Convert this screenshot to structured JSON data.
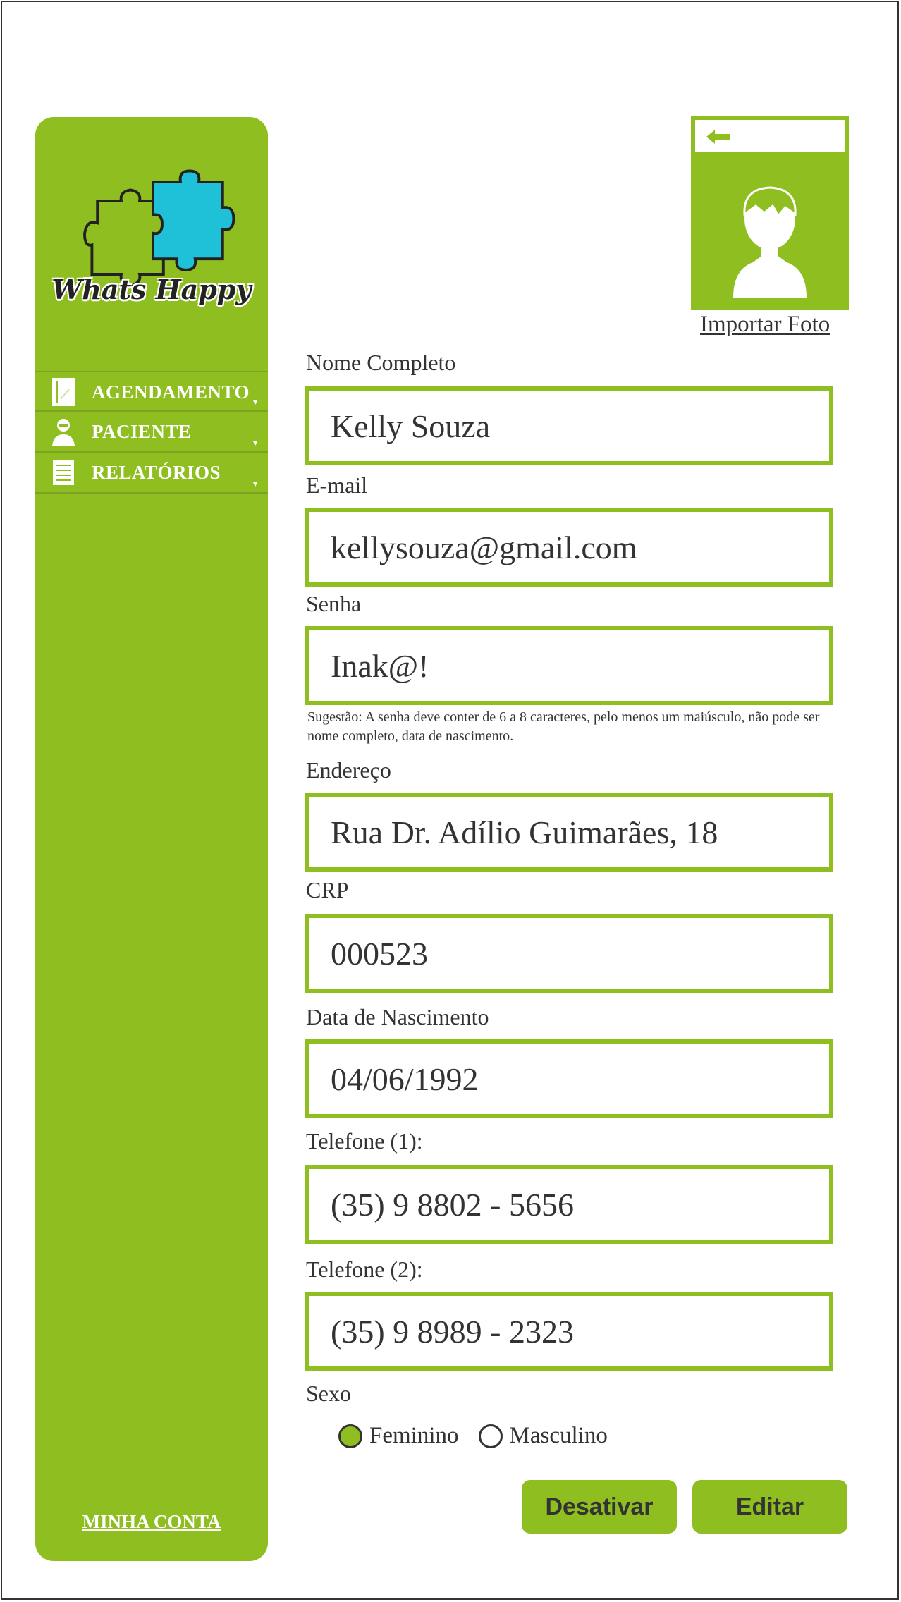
{
  "brand": {
    "name": "Whats Happy"
  },
  "sidebar": {
    "items": [
      {
        "label": "AGENDAMENTO",
        "icon": "notebook-icon"
      },
      {
        "label": "PACIENTE",
        "icon": "person-icon"
      },
      {
        "label": "RELATÓRIOS",
        "icon": "document-icon"
      }
    ],
    "account_label": "MINHA CONTA"
  },
  "photo": {
    "import_label": "Importar Foto"
  },
  "form": {
    "name": {
      "label": "Nome Completo",
      "value": "Kelly Souza"
    },
    "email": {
      "label": "E-mail",
      "value": "kellysouza@gmail.com"
    },
    "password": {
      "label": "Senha",
      "value": "Inak@!",
      "hint": "Sugestão: A senha deve conter de 6 a 8 caracteres, pelo menos um maiúsculo, não pode ser nome completo, data de nascimento."
    },
    "address": {
      "label": "Endereço",
      "value": "Rua Dr. Adílio Guimarães, 18"
    },
    "crp": {
      "label": "CRP",
      "value": "000523"
    },
    "birthdate": {
      "label": "Data de Nascimento",
      "value": "04/06/1992"
    },
    "phone1": {
      "label": "Telefone (1):",
      "value": "(35) 9 8802 - 5656"
    },
    "phone2": {
      "label": "Telefone (2):",
      "value": "(35) 9 8989 - 2323"
    },
    "sex": {
      "label": "Sexo",
      "options": [
        "Feminino",
        "Masculino"
      ],
      "selected": "Feminino"
    }
  },
  "actions": {
    "deactivate_label": "Desativar",
    "edit_label": "Editar"
  },
  "colors": {
    "accent": "#8fbe20",
    "puzzle_blue": "#1fc1d8"
  }
}
